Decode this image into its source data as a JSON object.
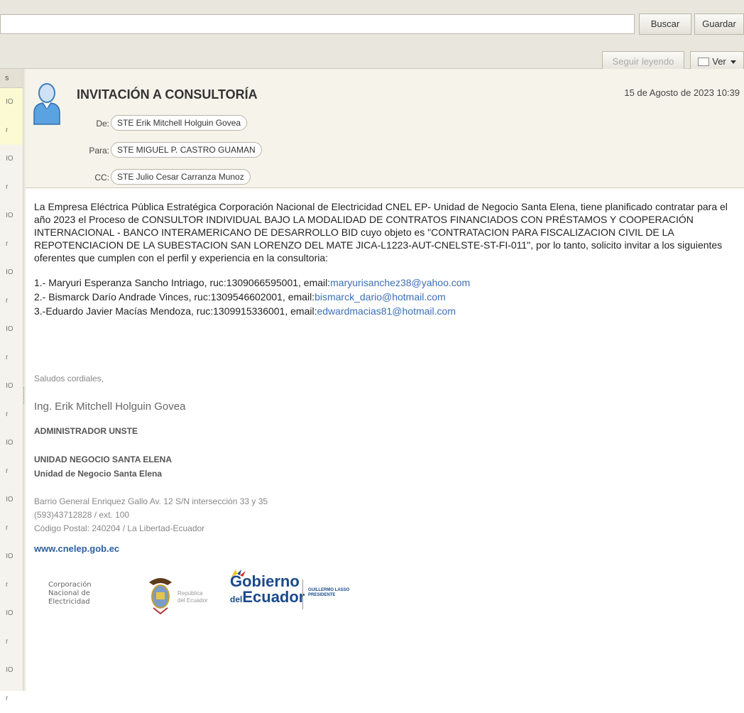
{
  "toolbar": {
    "search_placeholder": "",
    "search_label": "Buscar",
    "save_label": "Guardar",
    "read_more_label": "Seguir leyendo",
    "view_label": "Ver"
  },
  "left_column": {
    "header": "s",
    "rows": [
      "IO",
      "r",
      "IO",
      "r",
      "IO",
      "r",
      "IO",
      "r",
      "IO",
      "r",
      "IO",
      "r",
      "IO",
      "r",
      "IO",
      "r",
      "IO",
      "r",
      "IO",
      "r",
      "IO",
      "r"
    ]
  },
  "message": {
    "subject": "INVITACIÓN A CONSULTORÍA",
    "date": "15 de Agosto de 2023 10:39",
    "from_label": "De:",
    "from": "STE Erik Mitchell Holguin Govea",
    "to_label": "Para:",
    "to": "STE MIGUEL P. CASTRO GUAMAN",
    "cc_label": "CC:",
    "cc": "STE Julio Cesar Carranza Munoz",
    "body_paragraph": "La Empresa Eléctrica Pública Estratégica Corporación Nacional de Electricidad CNEL EP- Unidad de Negocio Santa Elena, tiene planificado contratar para el año 2023 el Proceso de CONSULTOR INDIVIDUAL BAJO LA MODALIDAD DE CONTRATOS FINANCIADOS CON PRÉSTAMOS Y COOPERACIÓN INTERNACIONAL - BANCO INTERAMERICANO DE DESARROLLO BID cuyo objeto es \"CONTRATACION PARA FISCALIZACION CIVIL DE LA REPOTENCIACION DE LA SUBESTACION SAN LORENZO DEL MATE JICA-L1223-AUT-CNELSTE-ST-FI-011\", por lo tanto, solicito invitar a los siguientes oferentes que cumplen con el perfil y experiencia en la consultoria:",
    "invitees": [
      {
        "text": "1.- Maryuri Esperanza Sancho Intriago, ruc:1309066595001, email:",
        "email": "maryurisanchez38@yahoo.com"
      },
      {
        "text": "2.- Bismarck Darío Andrade Vinces, ruc:1309546602001, email:",
        "email": "bismarck_dario@hotmail.com"
      },
      {
        "text": "3.-Eduardo Javier Macías Mendoza, ruc:1309915336001, email:",
        "email": "edwardmacias81@hotmail.com"
      }
    ]
  },
  "signature": {
    "greeting": "Saludos cordiales,",
    "name": "Ing. Erik Mitchell Holguin Govea",
    "role": "ADMINISTRADOR UNSTE",
    "unit_upper": "UNIDAD NEGOCIO SANTA ELENA",
    "unit": "Unidad de Negocio Santa Elena",
    "address_lines": [
      "Barrio General Enriquez Gallo Av. 12 S/N intersección 33 y 35",
      "(593)43712828 / ext. 100",
      "Código Postal: 240204 / La Libertad-Ecuador"
    ],
    "website": "www.cnelep.gob.ec"
  },
  "logos": {
    "cnel_lines": [
      "Corporación",
      "Nacional de",
      "Electricidad"
    ],
    "republica_lines": [
      "República",
      "del Ecuador"
    ],
    "gobierno_line1": "Gobierno",
    "gobierno_del": "del",
    "gobierno_line2": "Ecuador",
    "lasso_lines": [
      "GUILLERMO LASSO",
      "PRESIDENTE"
    ]
  },
  "colors": {
    "toolbar_bg": "#e9e7dd",
    "header_bg": "#f5f3ea",
    "link": "#3b6fb6",
    "brand_blue": "#1a4a8a"
  }
}
